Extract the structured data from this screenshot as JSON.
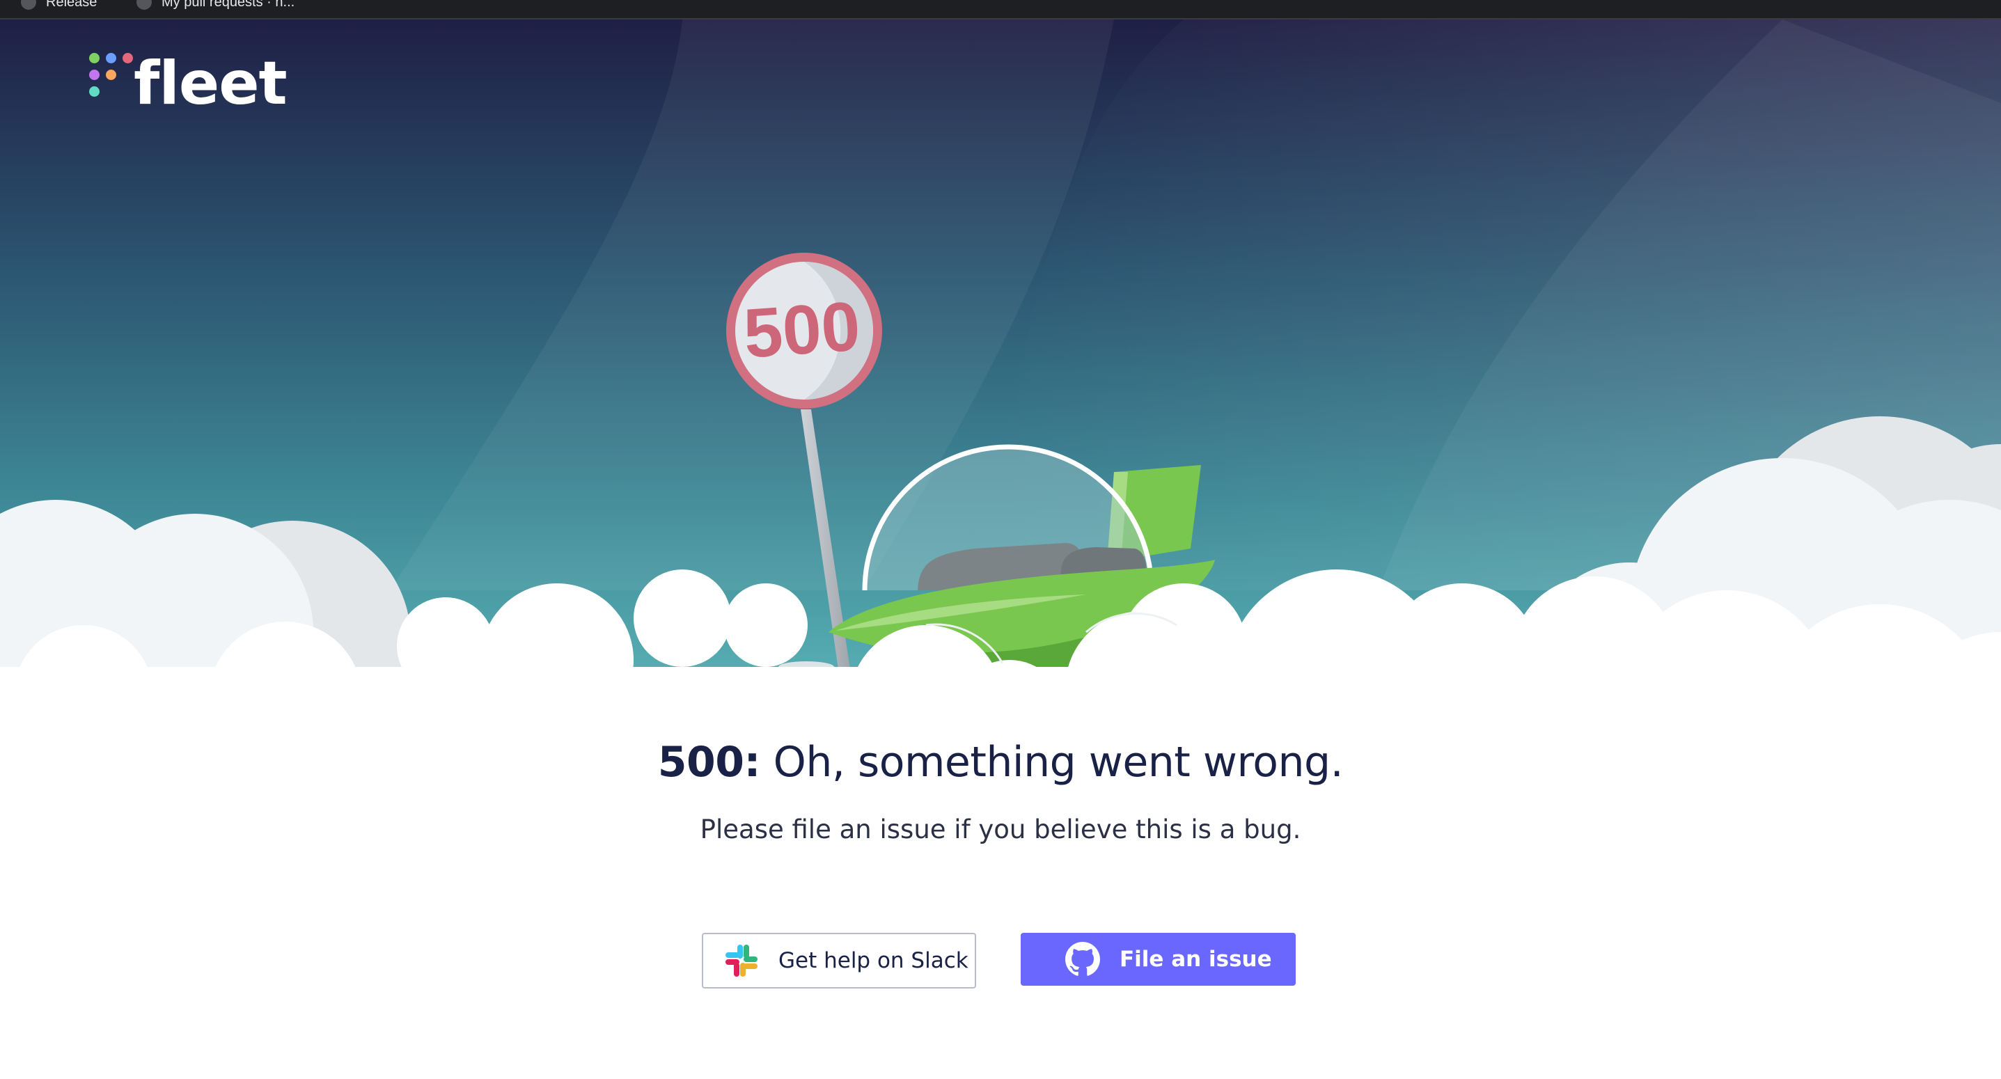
{
  "browser": {
    "bookmarks": [
      {
        "label": "Release",
        "icon": "github-icon"
      },
      {
        "label": "My pull requests · n...",
        "icon": "github-icon"
      }
    ]
  },
  "logo": {
    "text": "fleet",
    "dot_colors": [
      "#7fd262",
      "#6a9ffe",
      "#e2697b",
      "#c277ee",
      "#f7a75f",
      "#61dbc2"
    ]
  },
  "illustration": {
    "sign_text": "500"
  },
  "error": {
    "code": "500:",
    "message": " Oh, something went wrong.",
    "subtext": "Please file an issue if you believe this is a bug."
  },
  "actions": {
    "slack_label": "Get help on Slack",
    "slack_icon": "slack-icon",
    "issue_label": "File an issue",
    "issue_icon": "github-icon"
  },
  "colors": {
    "primary": "#6a67fe",
    "text": "#192147",
    "sign_red": "#d07080",
    "ship_green": "#7ac74f"
  }
}
